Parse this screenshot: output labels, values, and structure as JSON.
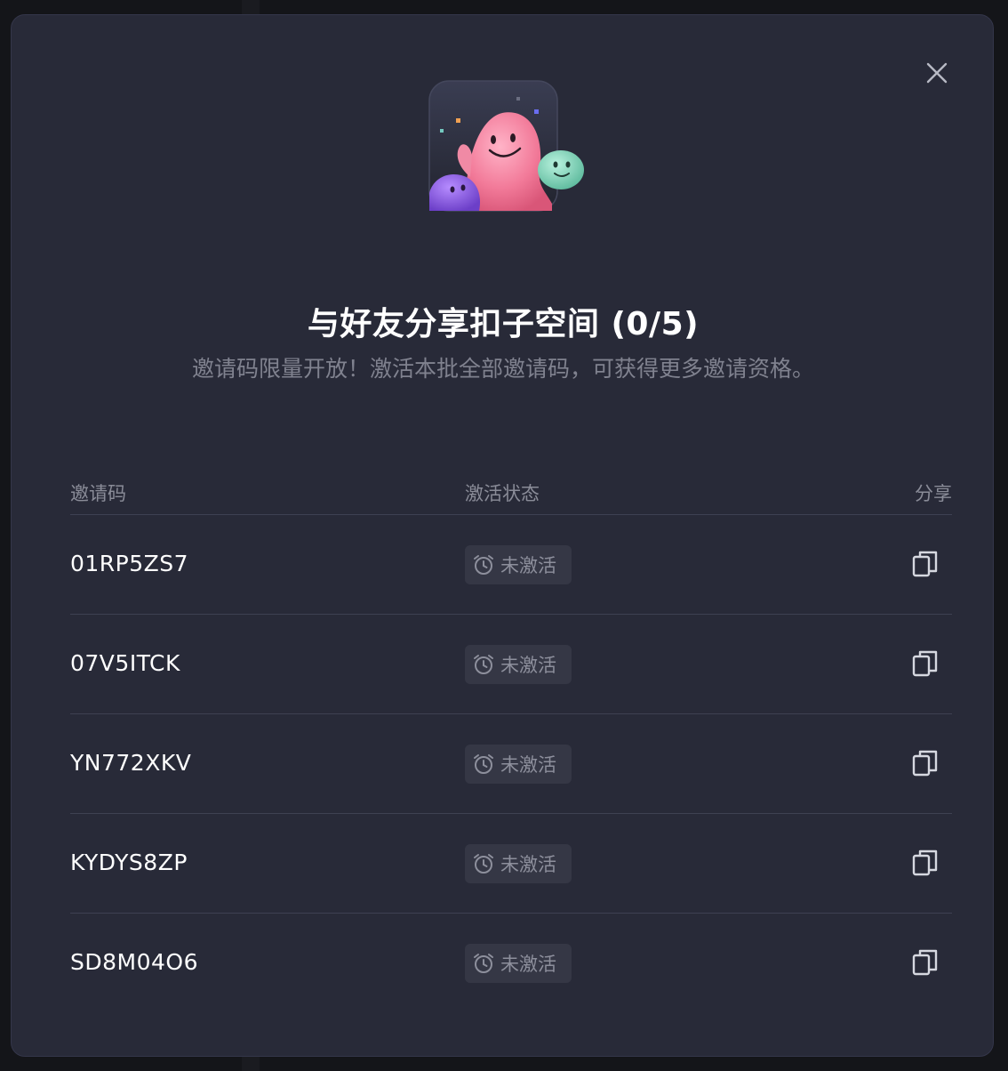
{
  "dialog": {
    "title": "与好友分享扣子空间 (0/5)",
    "subtitle": "邀请码限量开放！激活本批全部邀请码，可获得更多邀请资格。",
    "close_icon": "close-icon",
    "illustration_icon": "friends-mascot-icon"
  },
  "table": {
    "headers": {
      "code": "邀请码",
      "status": "激活状态",
      "share": "分享"
    },
    "rows": [
      {
        "code": "01RP5ZS7",
        "status": "未激活",
        "status_icon": "alarm-clock-icon",
        "share_icon": "copy-icon"
      },
      {
        "code": "07V5ITCK",
        "status": "未激活",
        "status_icon": "alarm-clock-icon",
        "share_icon": "copy-icon"
      },
      {
        "code": "YN772XKV",
        "status": "未激活",
        "status_icon": "alarm-clock-icon",
        "share_icon": "copy-icon"
      },
      {
        "code": "KYDYS8ZP",
        "status": "未激活",
        "status_icon": "alarm-clock-icon",
        "share_icon": "copy-icon"
      },
      {
        "code": "SD8M04O6",
        "status": "未激活",
        "status_icon": "alarm-clock-icon",
        "share_icon": "copy-icon"
      }
    ]
  },
  "colors": {
    "dialog_bg": "#282a38",
    "badge_bg": "#353745",
    "divider": "#3e4152",
    "title_text": "#ffffff",
    "muted_text": "#80828f"
  }
}
